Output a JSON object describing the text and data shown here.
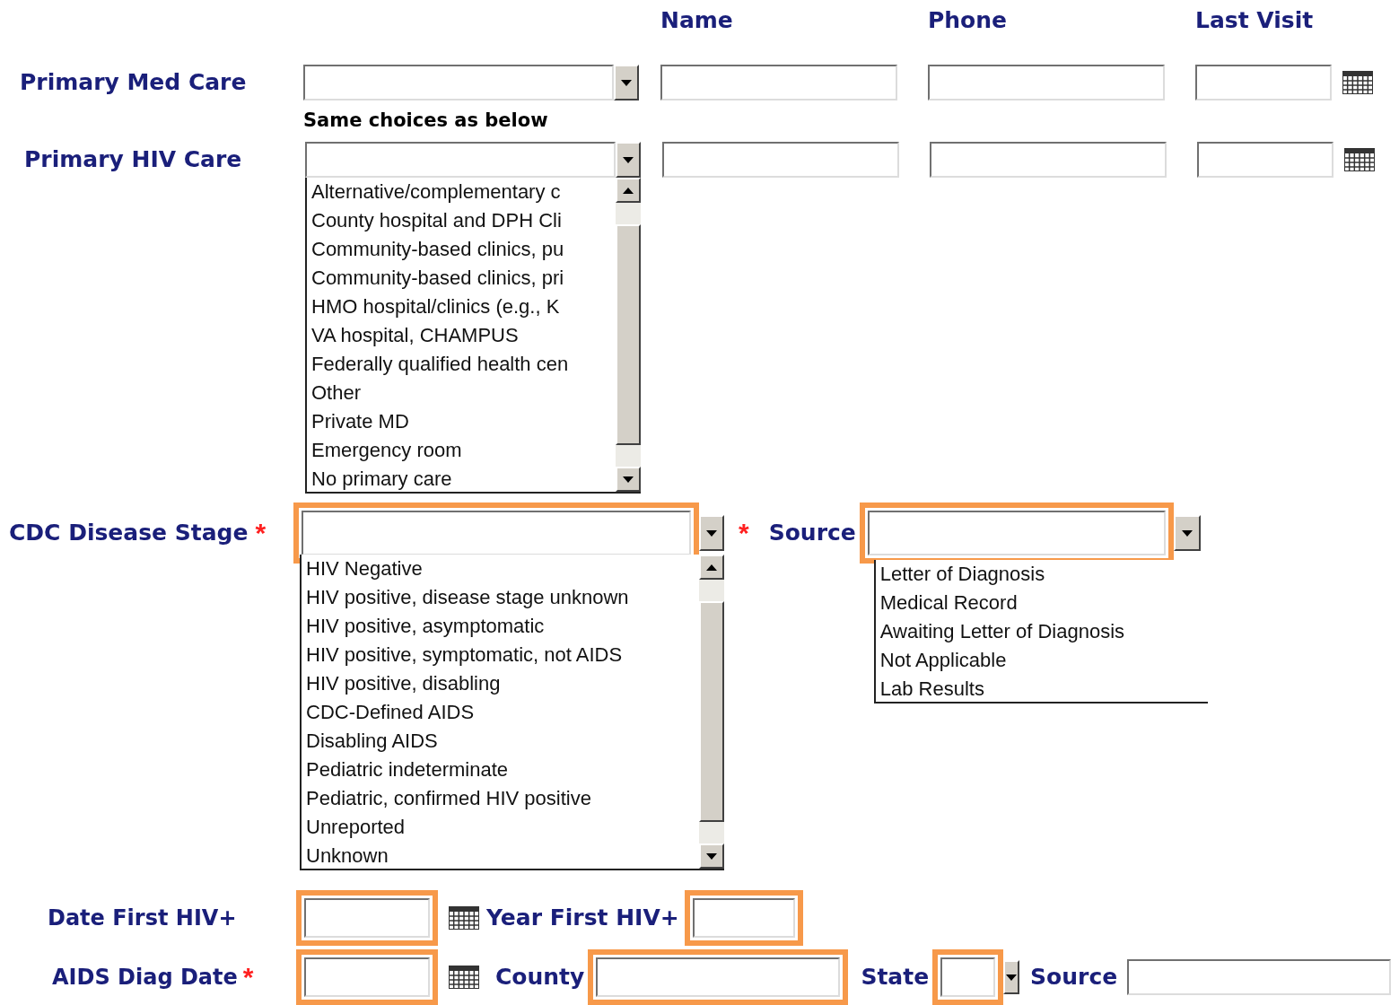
{
  "columns": [
    {
      "label": "Name"
    },
    {
      "label": "Phone"
    },
    {
      "label": "Last Visit"
    }
  ],
  "care_rows": [
    {
      "label": "Primary Med Care",
      "note": "Same choices as below"
    },
    {
      "label": "Primary HIV Care",
      "expanded": true,
      "options": [
        "Alternative/complementary c",
        "County hospital and DPH Cli",
        "Community-based clinics, pu",
        "Community-based clinics, pri",
        "HMO hospital/clinics (e.g., K",
        "VA hospital, CHAMPUS",
        "Federally qualified health cen",
        "Other",
        "Private MD",
        "Emergency room",
        "No primary care"
      ]
    }
  ],
  "disease_stage": {
    "label": "CDC Disease Stage",
    "required_mark": "*",
    "highlighted": true,
    "expanded": true,
    "options": [
      "HIV Negative",
      "HIV positive, disease stage unknown",
      "HIV positive, asymptomatic",
      "HIV positive, symptomatic, not AIDS",
      "HIV positive, disabling",
      "CDC-Defined AIDS",
      "Disabling AIDS",
      "Pediatric indeterminate",
      "Pediatric, confirmed HIV positive",
      "Unreported",
      "Unknown"
    ]
  },
  "source": {
    "label": "Source",
    "required_mark": "*",
    "highlighted": true,
    "expanded": true,
    "options": [
      "Letter of Diagnosis",
      "Medical Record",
      "Awaiting Letter of Diagnosis",
      "Not Applicable",
      "Lab Results"
    ]
  },
  "date_first_hiv": {
    "label": "Date First HIV+",
    "highlighted": true
  },
  "year_first_hiv": {
    "label": "Year First HIV+",
    "highlighted": true
  },
  "aids_diag_date": {
    "label": "AIDS Diag Date",
    "required_mark": "*",
    "highlighted": true
  },
  "county": {
    "label": "County",
    "highlighted": true
  },
  "state": {
    "label": "State",
    "highlighted": true
  },
  "report_source": {
    "label": "Source",
    "highlighted": false
  }
}
